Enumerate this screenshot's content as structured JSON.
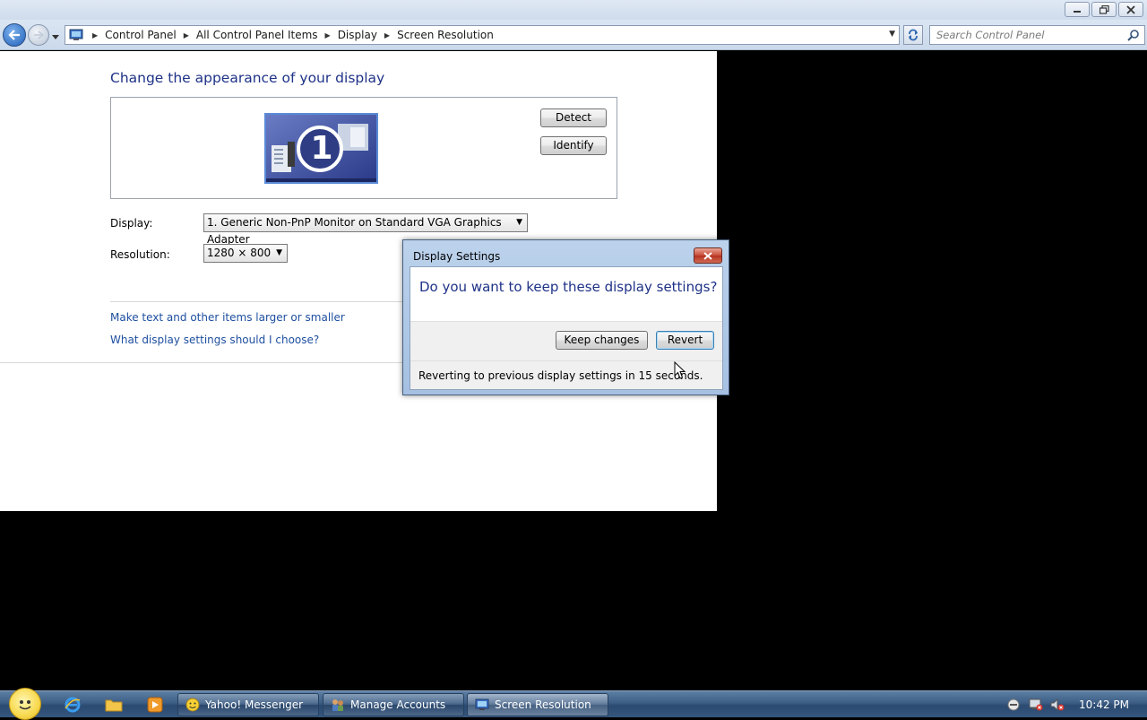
{
  "window": {
    "title_buttons": [
      "minimize",
      "restore",
      "close"
    ]
  },
  "nav": {
    "breadcrumbs": [
      "Control Panel",
      "All Control Panel Items",
      "Display",
      "Screen Resolution"
    ],
    "search_placeholder": "Search Control Panel"
  },
  "main": {
    "heading": "Change the appearance of your display",
    "monitor_number": "1",
    "detect_label": "Detect",
    "identify_label": "Identify",
    "display_label": "Display:",
    "display_value": "1. Generic Non-PnP Monitor on Standard VGA Graphics Adapter",
    "resolution_label": "Resolution:",
    "resolution_value": "1280 × 800",
    "links": [
      "Make text and other items larger or smaller",
      "What display settings should I choose?"
    ]
  },
  "dialog": {
    "title": "Display Settings",
    "question": "Do you want to keep these display settings?",
    "keep_label": "Keep changes",
    "revert_label": "Revert",
    "footer": "Reverting to previous display settings in 15 seconds."
  },
  "taskbar": {
    "windows": [
      {
        "label": "Yahoo! Messenger",
        "icon": "yahoo-messenger-icon"
      },
      {
        "label": "Manage Accounts",
        "icon": "manage-accounts-icon"
      },
      {
        "label": "Screen Resolution",
        "icon": "screen-resolution-icon"
      }
    ],
    "clock": "10:42 PM"
  },
  "colors": {
    "heading": "#1e3287",
    "link": "#1e4fa0",
    "taskbar": "#3c5d85"
  }
}
